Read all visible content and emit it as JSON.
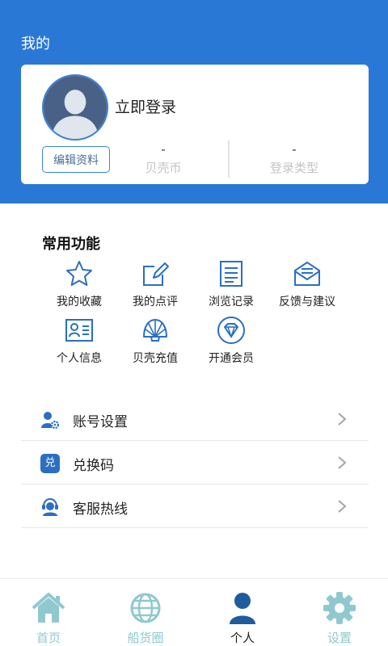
{
  "header": {
    "title": "我的"
  },
  "profile": {
    "login_text": "立即登录",
    "edit_label": "编辑资料",
    "coins": {
      "value": "-",
      "label": "贝壳币"
    },
    "login_type": {
      "value": "-",
      "label": "登录类型"
    }
  },
  "features": {
    "title": "常用功能",
    "items": [
      {
        "label": "我的收藏",
        "icon": "star-icon"
      },
      {
        "label": "我的点评",
        "icon": "edit-icon"
      },
      {
        "label": "浏览记录",
        "icon": "history-icon"
      },
      {
        "label": "反馈与建议",
        "icon": "feedback-icon"
      },
      {
        "label": "个人信息",
        "icon": "id-card-icon"
      },
      {
        "label": "贝壳充值",
        "icon": "shell-icon"
      },
      {
        "label": "开通会员",
        "icon": "diamond-icon"
      }
    ]
  },
  "menu": [
    {
      "label": "账号设置",
      "icon": "account-settings-icon"
    },
    {
      "label": "兑换码",
      "icon": "redeem-code-icon",
      "icon_text": "兑"
    },
    {
      "label": "客服热线",
      "icon": "customer-service-icon"
    }
  ],
  "tabbar": [
    {
      "label": "首页",
      "icon": "home-icon",
      "active": false
    },
    {
      "label": "船货圈",
      "icon": "globe-icon",
      "active": false
    },
    {
      "label": "个人",
      "icon": "person-icon",
      "active": true
    },
    {
      "label": "设置",
      "icon": "settings-icon",
      "active": false
    }
  ],
  "colors": {
    "header": "#2a78d6",
    "accent": "#3a82d8",
    "tab_inactive": "#8fc9cf",
    "tab_active": "#1f5c9e"
  }
}
